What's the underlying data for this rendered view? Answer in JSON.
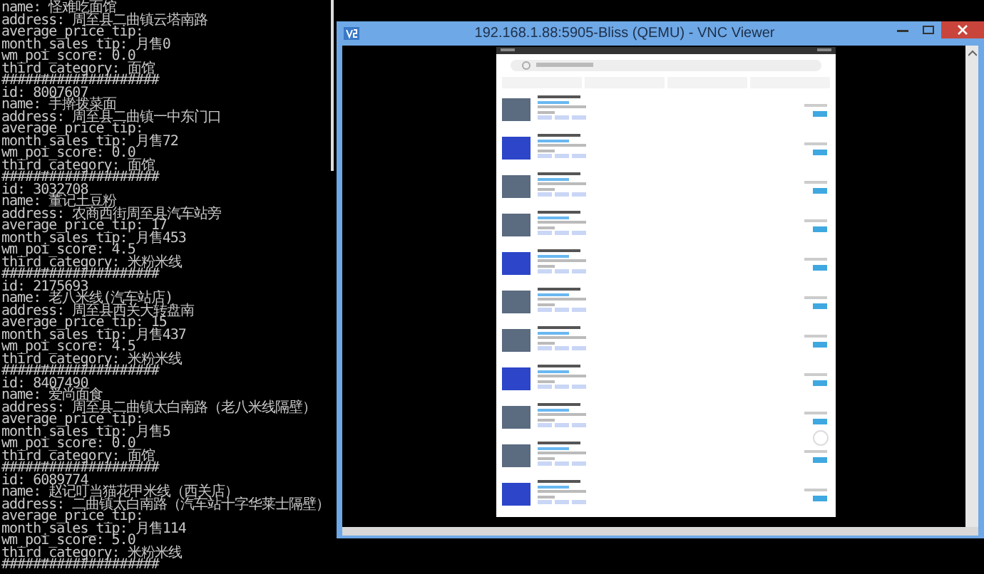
{
  "terminal": {
    "lines": [
      "name: 怪难吃面馆",
      "address: 周至县二曲镇云塔南路",
      "average_price_tip:",
      "month_sales_tip: 月售0",
      "wm_poi_score: 0.0",
      "third_category: 面馆",
      "####################",
      "id: 8007607",
      "name: 手擀拨菜面",
      "address: 周至县二曲镇一中东门口",
      "average_price_tip:",
      "month_sales_tip: 月售72",
      "wm_poi_score: 0.0",
      "third_category: 面馆",
      "####################",
      "id: 3032708",
      "name: 董记土豆粉",
      "address: 农商西街周至县汽车站旁",
      "average_price_tip: 17",
      "month_sales_tip: 月售453",
      "wm_poi_score: 4.5",
      "third_category: 米粉米线",
      "####################",
      "id: 2175693",
      "name: 老八米线(汽车站店)",
      "address: 周至县西关大转盘南",
      "average_price_tip: 15",
      "month_sales_tip: 月售437",
      "wm_poi_score: 4.5",
      "third_category: 米粉米线",
      "####################",
      "id: 8407490",
      "name: 爱尚面食",
      "address: 周至县二曲镇太白南路（老八米线隔壁）",
      "average_price_tip:",
      "month_sales_tip: 月售5",
      "wm_poi_score: 0.0",
      "third_category: 面馆",
      "####################",
      "id: 6089774",
      "name: 赵记叮当猫花甲米线（西关店）",
      "address: 二曲镇太白南路（汽车站十字华莱士隔壁）",
      "average_price_tip:",
      "month_sales_tip: 月售114",
      "wm_poi_score: 5.0",
      "third_category: 米粉米线",
      "####################"
    ]
  },
  "vnc_window": {
    "title": "192.168.1.88:5905-Bliss (QEMU) - VNC Viewer"
  }
}
